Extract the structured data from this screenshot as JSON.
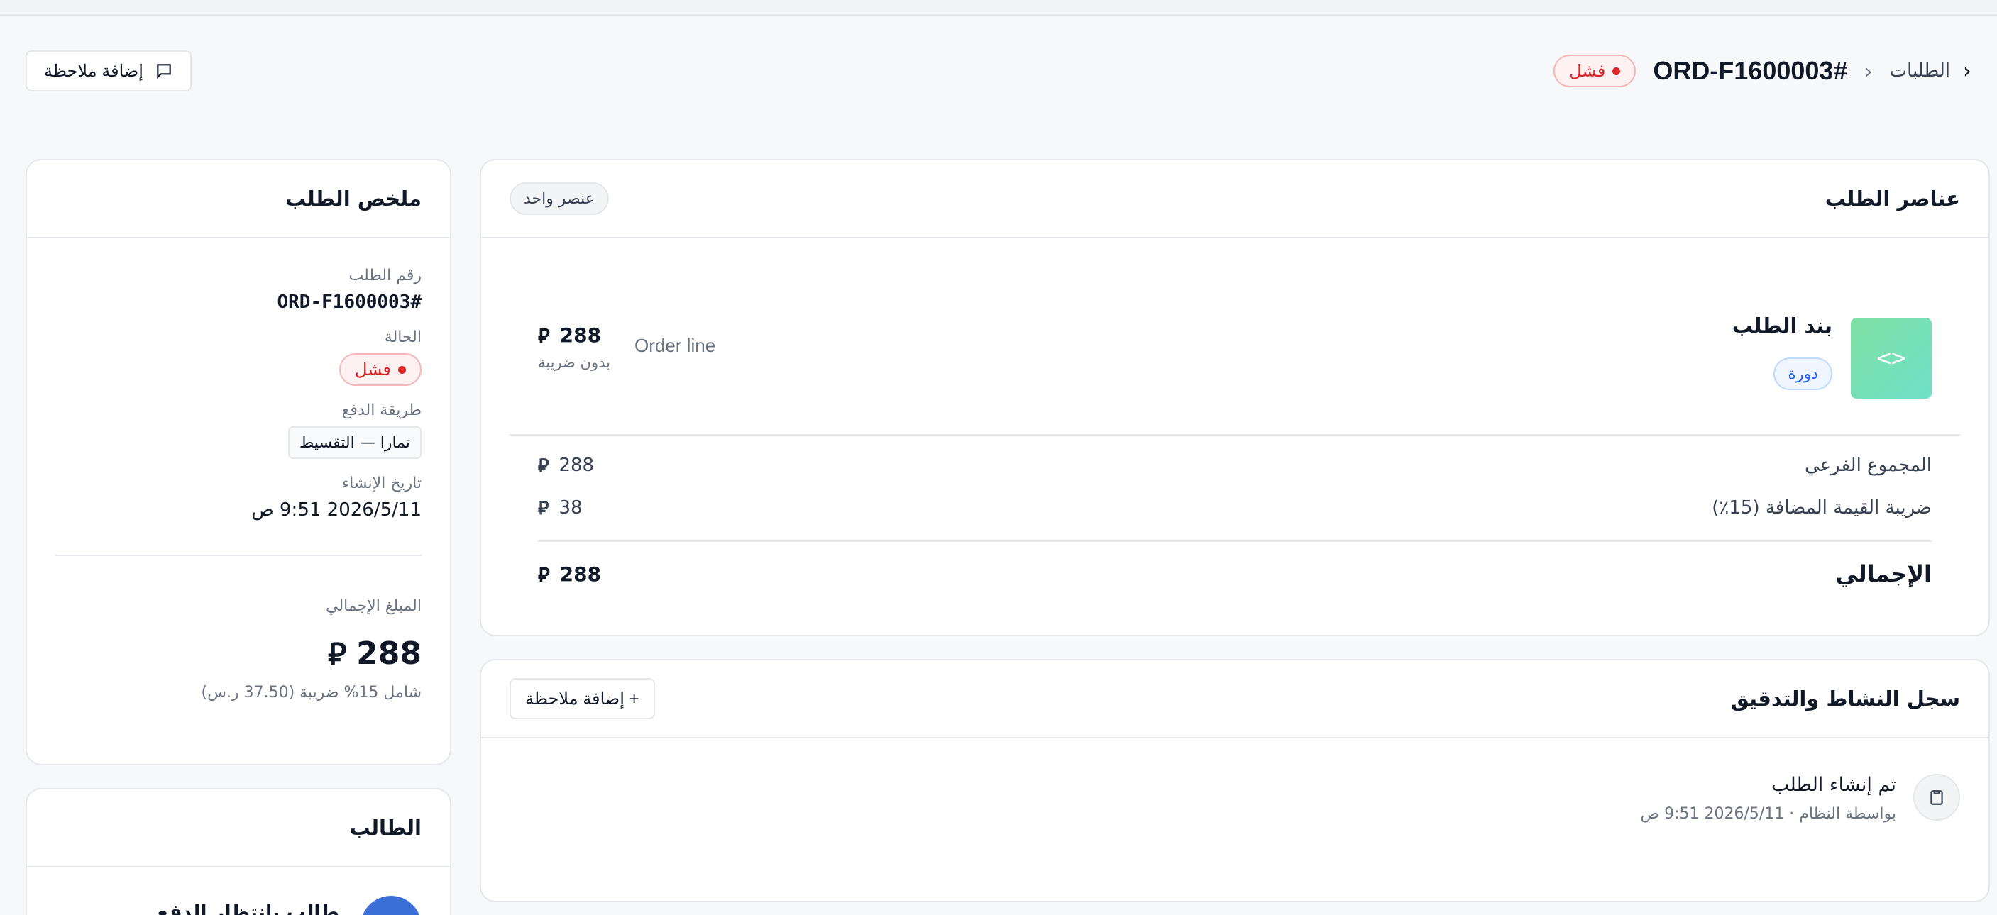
{
  "header": {
    "breadcrumb_label": "الطلبات",
    "order_title": "ORD-F1600003#",
    "status_badge": "فشل",
    "add_note_button": "إضافة ملاحظة"
  },
  "items_card": {
    "title": "عناصر الطلب",
    "count_badge": "عنصر واحد",
    "item": {
      "name": "بند الطلب",
      "type_tag": "دورة",
      "description": "Order line",
      "price": "288",
      "price_note": "بدون ضريبة",
      "thumb_icon": "code-icon"
    },
    "totals": {
      "subtotal_label": "المجموع الفرعي",
      "subtotal_value": "288",
      "vat_label": "ضريبة القيمة المضافة (15٪)",
      "vat_value": "38",
      "grand_label": "الإجمالي",
      "grand_value": "288"
    },
    "currency_symbol": "⃁"
  },
  "activity_card": {
    "title": "سجل النشاط والتدقيق",
    "add_note_button": "+ إضافة ملاحظة",
    "entries": [
      {
        "title": "تم إنشاء الطلب",
        "meta": "بواسطة النظام · 2026/5/11 9:51 ص",
        "icon": "clipboard-icon"
      }
    ]
  },
  "summary_card": {
    "title": "ملخص الطلب",
    "order_number_label": "رقم الطلب",
    "order_number": "ORD-F1600003#",
    "status_label": "الحالة",
    "status": "فشل",
    "payment_method_label": "طريقة الدفع",
    "payment_method": "تمارا — التقسيط",
    "created_label": "تاريخ الإنشاء",
    "created_value": "2026/5/11 9:51 ص",
    "total_label": "المبلغ الإجمالي",
    "total_value": "288",
    "tax_note": "شامل 15% ضريبة (37.50 ر.س)"
  },
  "student_card": {
    "title": "الطالب",
    "name": "طالب بانتظار الدفع"
  },
  "colors": {
    "fail": "#dc2626",
    "accent_blue": "#2563eb",
    "thumb_green": "#7ee0a3"
  }
}
